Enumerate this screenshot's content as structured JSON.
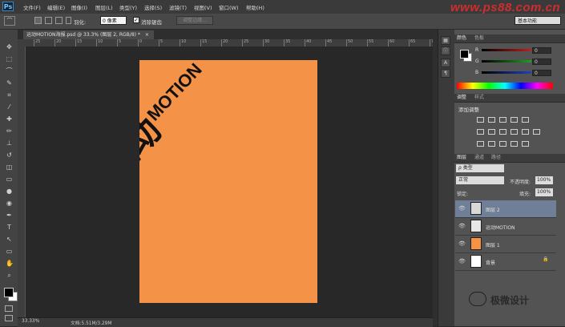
{
  "app": {
    "logo": "Ps",
    "watermark": "www.ps88.com.cn"
  },
  "menu": [
    "文件(F)",
    "编辑(E)",
    "图像(I)",
    "图层(L)",
    "类型(Y)",
    "选择(S)",
    "滤镜(T)",
    "视图(V)",
    "窗口(W)",
    "帮助(H)"
  ],
  "options": {
    "feather_label": "羽化:",
    "feather_value": "0 像素",
    "antialias_checked": "✓",
    "antialias_label": "消除锯齿",
    "refine_edge": "调整边缘...",
    "workspace": "基本功能"
  },
  "tools": [
    "move-tool-icon",
    "marquee-tool-icon",
    "lasso-tool-icon",
    "quick-select-tool-icon",
    "crop-tool-icon",
    "eyedropper-tool-icon",
    "healing-brush-icon",
    "brush-tool-icon",
    "clone-stamp-icon",
    "history-brush-icon",
    "eraser-tool-icon",
    "gradient-tool-icon",
    "blur-tool-icon",
    "dodge-tool-icon",
    "pen-tool-icon",
    "type-tool-icon",
    "path-select-icon",
    "shape-tool-icon",
    "hand-tool-icon",
    "zoom-tool-icon"
  ],
  "document": {
    "tab_title": "运动MOTION海报.psd @ 33.3% (图层 2, RGB/8) *",
    "tab_close": "×",
    "ruler_ticks": [
      "25",
      "20",
      "15",
      "10",
      "5",
      "0",
      "5",
      "10",
      "15",
      "20",
      "25",
      "30",
      "35",
      "40",
      "45",
      "50",
      "55",
      "60",
      "65",
      "70"
    ],
    "artwork_cn": "运动",
    "artwork_en": "MOTION",
    "zoom": "33.33%",
    "doc_size": "文档:5.51M/3.29M"
  },
  "color_panel": {
    "tabs": [
      "颜色",
      "色板"
    ],
    "channels": [
      {
        "label": "R",
        "value": "0",
        "color": "#c02020"
      },
      {
        "label": "G",
        "value": "0",
        "color": "#20a020"
      },
      {
        "label": "B",
        "value": "0",
        "color": "#2040c0"
      }
    ]
  },
  "adjust_panel": {
    "tabs": [
      "调整",
      "样式"
    ],
    "title": "添加调整"
  },
  "layers_panel": {
    "tabs": [
      "图层",
      "通道",
      "路径"
    ],
    "filter": "ρ 类型",
    "blend_mode": "正常",
    "opacity_label": "不透明度:",
    "opacity_value": "100%",
    "lock_label": "锁定:",
    "fill_label": "填充:",
    "fill_value": "100%",
    "layers": [
      {
        "name": "图层 2",
        "eye": "👁",
        "thumb_color": "#d8d8d8",
        "selected": true
      },
      {
        "name": "运动MOTION",
        "eye": "👁",
        "thumb_color": "#e6e6e6",
        "selected": false
      },
      {
        "name": "图层 1",
        "eye": "👁",
        "thumb_color": "#f49247",
        "selected": false
      },
      {
        "name": "背景",
        "eye": "👁",
        "thumb_color": "#ffffff",
        "selected": false
      }
    ],
    "lock_icon": "🔒"
  },
  "wechat_badge": "极微设计"
}
